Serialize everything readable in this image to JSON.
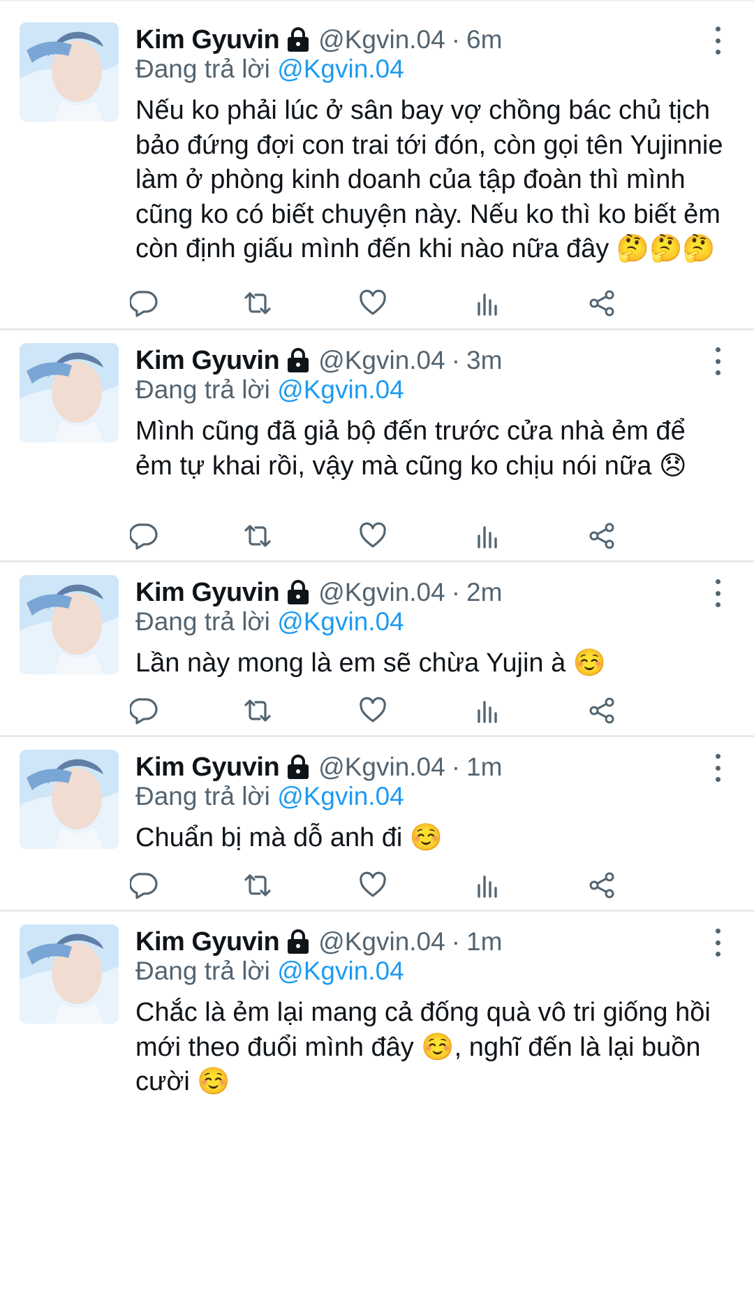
{
  "tweets": [
    {
      "name": "Kim Gyuvin",
      "handle": "@Kgvin.04",
      "separator": "·",
      "time": "6m",
      "replying_prefix": "Đang trả lời",
      "replying_to": "@Kgvin.04",
      "text": "Nếu ko phải lúc ở sân bay vợ chồng bác chủ tịch bảo đứng đợi con trai tới đón, còn gọi tên Yujinnie làm ở phòng kinh doanh của tập đoàn thì mình cũng ko có biết chuyện này. Nếu ko thì ko biết ẻm còn định giấu mình đến khi nào nữa đây 🤔🤔🤔"
    },
    {
      "name": "Kim Gyuvin",
      "handle": "@Kgvin.04",
      "separator": "·",
      "time": "3m",
      "replying_prefix": "Đang trả lời",
      "replying_to": "@Kgvin.04",
      "text": "Mình cũng đã giả bộ đến trước cửa nhà ẻm để ẻm tự khai rồi, vậy mà cũng ko chịu nói nữa 😞"
    },
    {
      "name": "Kim Gyuvin",
      "handle": "@Kgvin.04",
      "separator": "·",
      "time": "2m",
      "replying_prefix": "Đang trả lời",
      "replying_to": "@Kgvin.04",
      "text": "Lần này mong là em sẽ chừa Yujin à ☺️"
    },
    {
      "name": "Kim Gyuvin",
      "handle": "@Kgvin.04",
      "separator": "·",
      "time": "1m",
      "replying_prefix": "Đang trả lời",
      "replying_to": "@Kgvin.04",
      "text": "Chuẩn bị mà dỗ anh đi ☺️"
    },
    {
      "name": "Kim Gyuvin",
      "handle": "@Kgvin.04",
      "separator": "·",
      "time": "1m",
      "replying_prefix": "Đang trả lời",
      "replying_to": "@Kgvin.04",
      "text": "Chắc là ẻm lại mang cả đống quà vô tri giống hồi mới theo đuổi mình đây ☺️, nghĩ đến là lại buồn cười ☺️"
    }
  ],
  "icons": {
    "lock": "lock-icon",
    "more": "more-vertical-icon",
    "reply": "reply-icon",
    "retweet": "retweet-icon",
    "like": "heart-icon",
    "views": "views-icon",
    "share": "share-icon"
  },
  "colors": {
    "text": "#0f1419",
    "secondary": "#536471",
    "mention": "#1d9bf0",
    "divider": "#e6e9ec"
  }
}
